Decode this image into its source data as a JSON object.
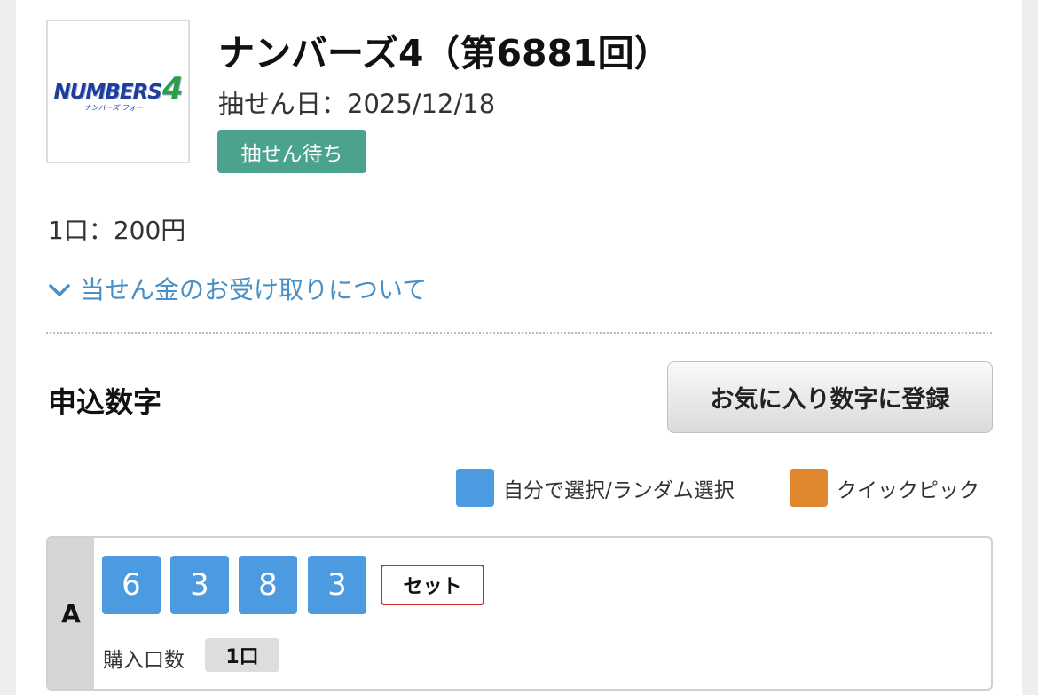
{
  "header": {
    "logo": {
      "brand_text": "NUMBERS4",
      "brand_subtext": "ナンバーズ フォー"
    },
    "title": "ナンバーズ4（第6881回）",
    "draw_date": "抽せん日：2025/12/18",
    "status": "抽せん待ち"
  },
  "info": {
    "price": "1口：200円",
    "prize_link_label": "当せん金のお受け取りについて"
  },
  "numbers_section": {
    "title": "申込数字",
    "favorite_button_label": "お気に入り数字に登録",
    "legend": [
      {
        "label": "自分で選択/ランダム選択",
        "color": "#4c9be0"
      },
      {
        "label": "クイックピック",
        "color": "#e0872e"
      }
    ]
  },
  "entries": [
    {
      "label": "A",
      "digits": [
        "6",
        "3",
        "8",
        "3"
      ],
      "type": "セット",
      "quantity_label": "購入口数",
      "quantity_value": "1口"
    }
  ],
  "colors": {
    "status_badge": "#4ba38f",
    "link": "#4a90c4",
    "digit_bg": "#4c9be0",
    "set_border": "#c9302c"
  }
}
